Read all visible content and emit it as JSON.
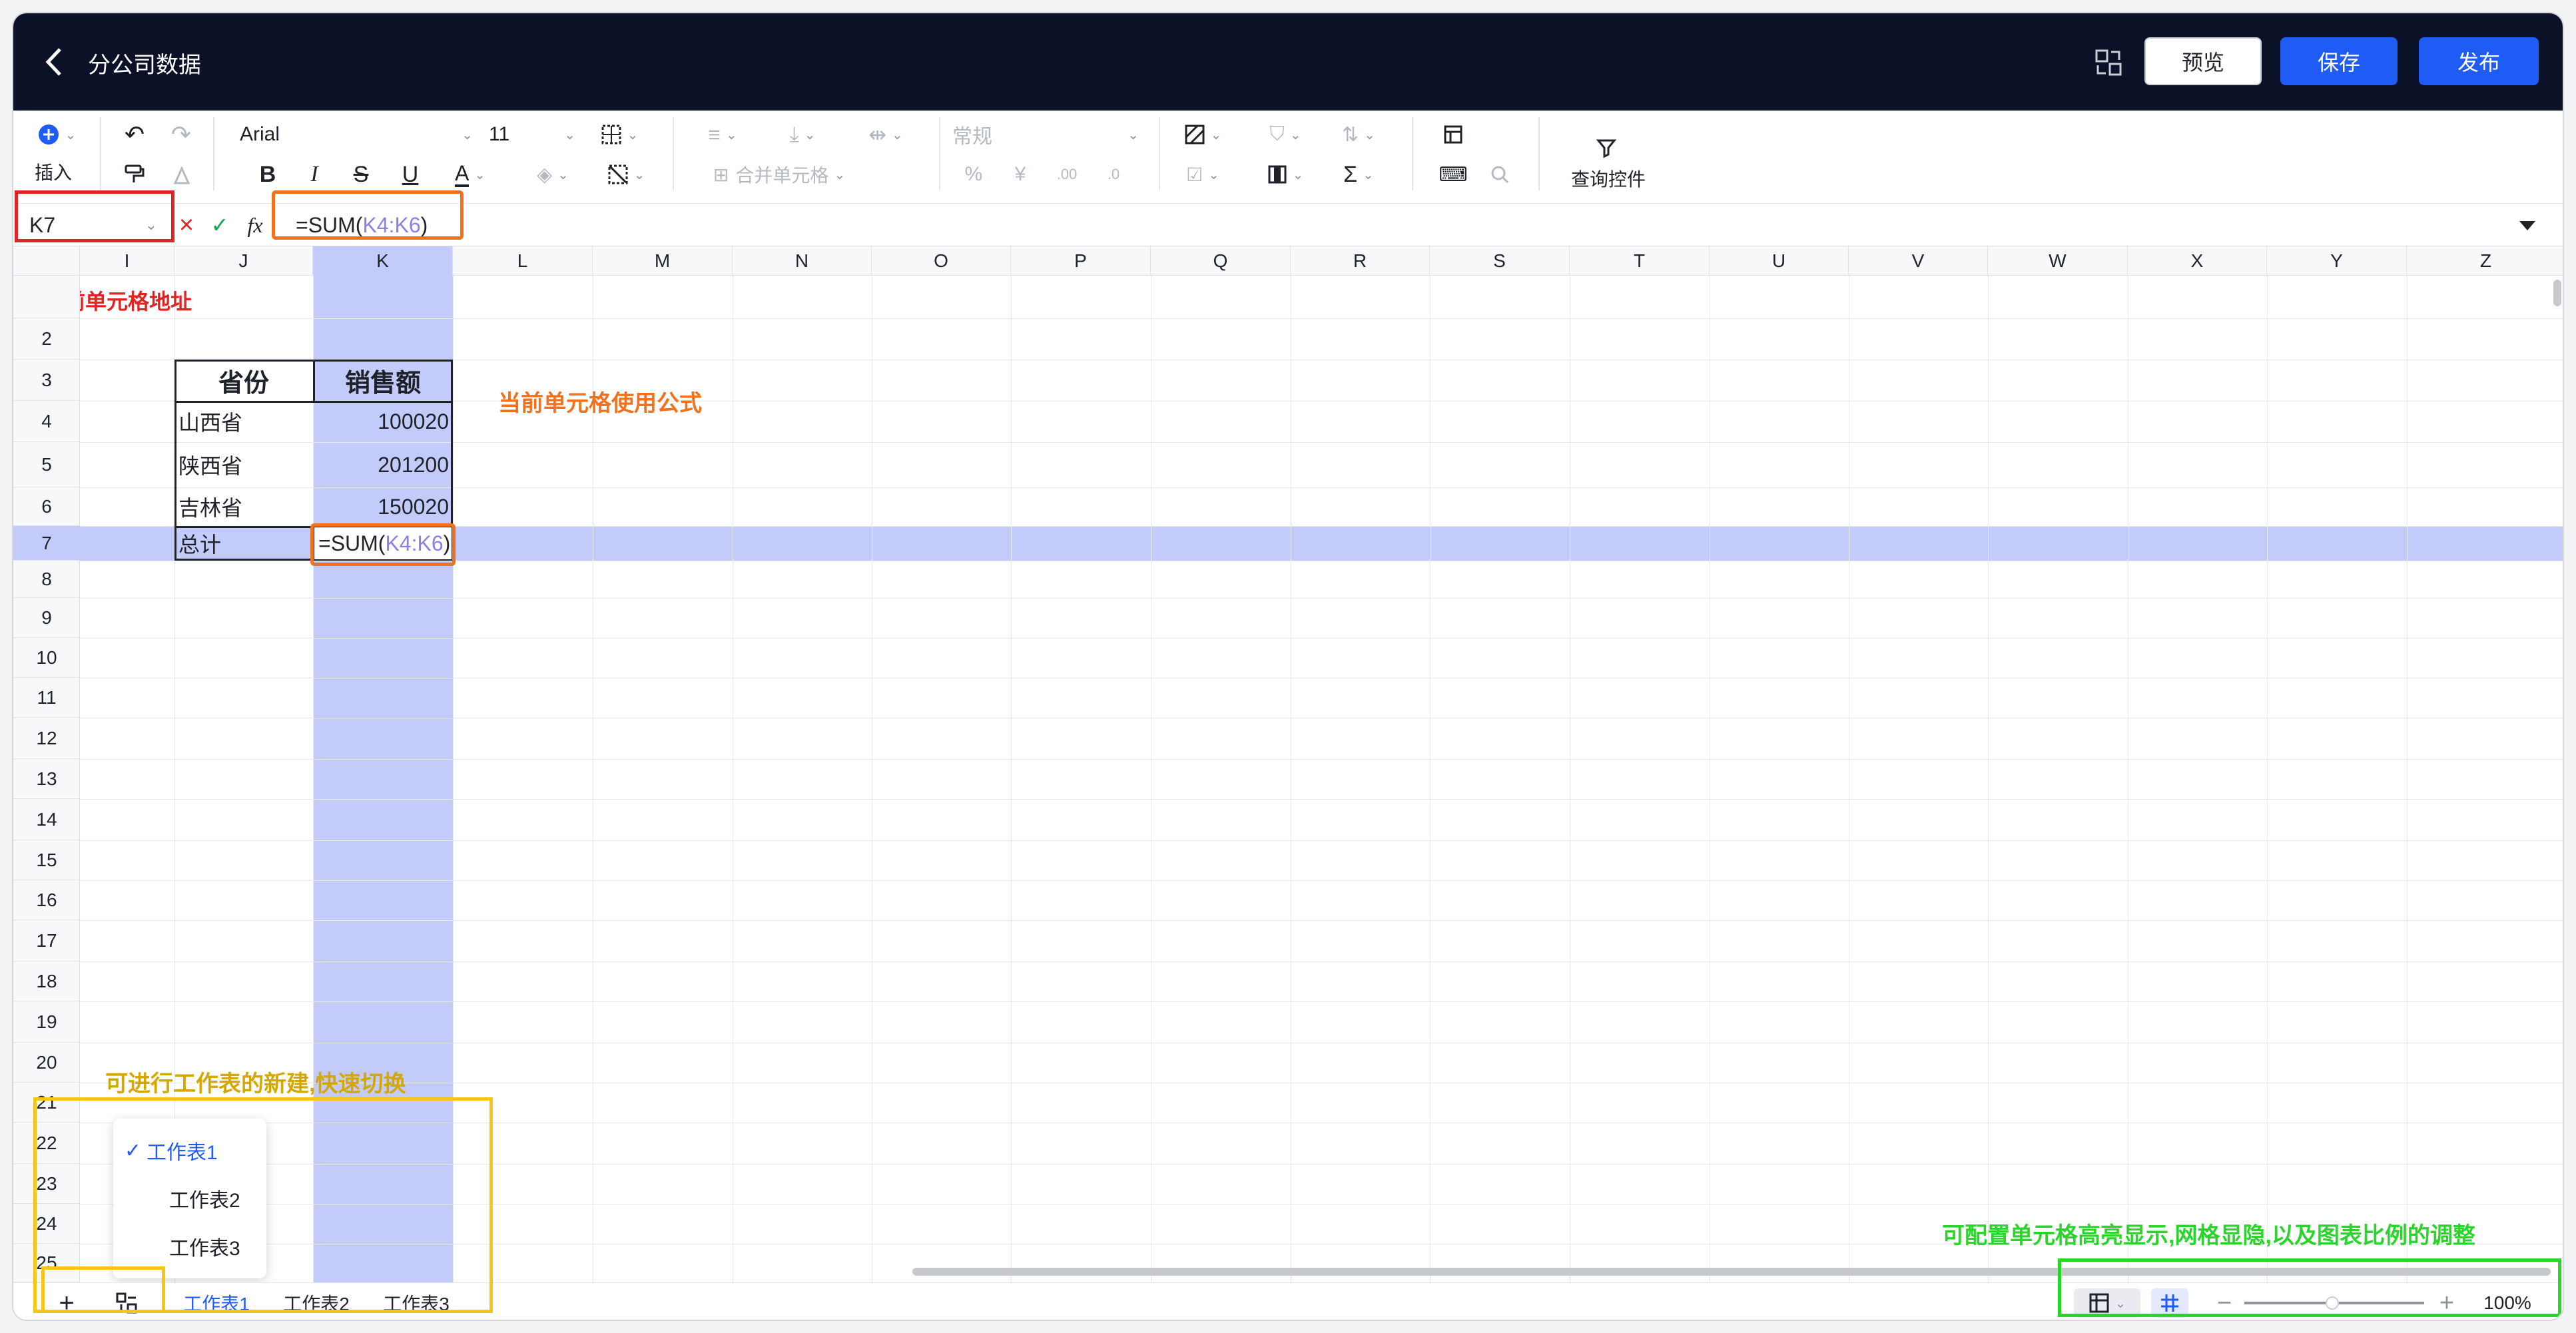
{
  "header": {
    "title": "分公司数据",
    "preview": "预览",
    "save": "保存",
    "publish": "发布"
  },
  "toolbar": {
    "insert_label": "插入",
    "font_name": "Arial",
    "font_size": "11",
    "merge_label": "合并单元格",
    "number_format": "常规",
    "query_label": "查询控件",
    "fx_label": "fx"
  },
  "formula_bar": {
    "cell_ref": "K7",
    "formula_prefix": "=SUM(",
    "formula_ref": "K4:K6",
    "formula_suffix": ")"
  },
  "columns": [
    "I",
    "J",
    "K",
    "L",
    "M",
    "N",
    "O",
    "P",
    "Q",
    "R",
    "S",
    "T",
    "U",
    "V",
    "W",
    "X",
    "Y",
    "Z"
  ],
  "rows": [
    "2",
    "3",
    "4",
    "5",
    "6",
    "7",
    "8",
    "9",
    "10",
    "11",
    "12",
    "13",
    "14",
    "15",
    "16",
    "17",
    "18",
    "19",
    "20",
    "21",
    "22",
    "23",
    "24",
    "25"
  ],
  "table": {
    "header": [
      "省份",
      "销售额"
    ],
    "rows": [
      [
        "山西省",
        "100020"
      ],
      [
        "陕西省",
        "201200"
      ],
      [
        "吉林省",
        "150020"
      ]
    ],
    "total_label": "总计"
  },
  "annotations": {
    "cell_address": "当前单元格地址",
    "formula": "当前单元格使用公式",
    "sheets": "可进行工作表的新建,快速切换",
    "settings": "可配置单元格高亮显示,网格显隐,以及图表比例的调整"
  },
  "sheet_menu": [
    {
      "label": "工作表1",
      "checked": true
    },
    {
      "label": "工作表2",
      "checked": false
    },
    {
      "label": "工作表3",
      "checked": false
    }
  ],
  "sheet_tabs": [
    "工作表1",
    "工作表2",
    "工作表3"
  ],
  "zoom": "100%",
  "colors": {
    "header_bg": "#0b1228",
    "accent": "#1f5cf5",
    "highlight": "#c3cbfa",
    "red": "#e02424",
    "orange": "#f2711c",
    "yellow": "#f5c518",
    "green": "#2bd42b"
  }
}
